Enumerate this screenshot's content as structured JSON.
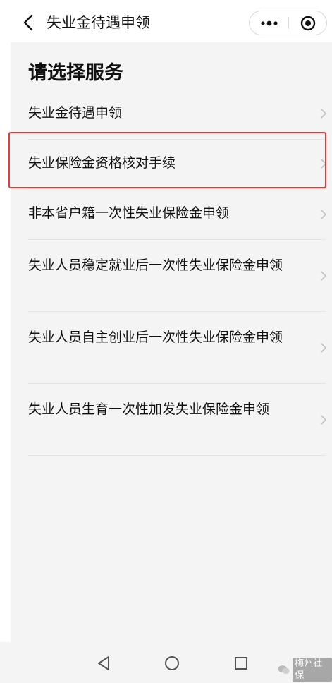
{
  "header": {
    "title": "失业金待遇申领",
    "back_icon": "chevron-left-icon",
    "more_icon": "more-dots-icon",
    "close_icon": "target-close-icon"
  },
  "main": {
    "page_title": "请选择服务",
    "items": [
      {
        "label": "失业金待遇申领",
        "highlighted": false
      },
      {
        "label": "失业保险金资格核对手续",
        "highlighted": true
      },
      {
        "label": "非本省户籍一次性失业保险金申领",
        "highlighted": false
      },
      {
        "label": "失业人员稳定就业后一次性失业保险金申领",
        "highlighted": false
      },
      {
        "label": "失业人员自主创业后一次性失业保险金申领",
        "highlighted": false
      },
      {
        "label": "失业人员生育一次性加发失业保险金申领",
        "highlighted": false
      }
    ],
    "highlight_color": "#e53935"
  },
  "navbar": {
    "back_icon": "triangle-back-icon",
    "home_icon": "circle-home-icon",
    "recent_icon": "square-recent-icon"
  },
  "watermark": {
    "text": "梅州社保"
  }
}
